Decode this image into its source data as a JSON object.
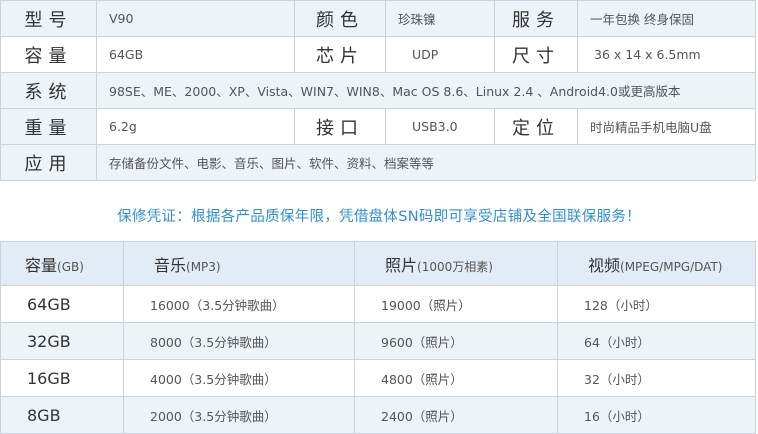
{
  "spec": {
    "model_label": "型号",
    "model_value": "V90",
    "color_label": "颜色",
    "color_value": "珍珠镍",
    "service_label": "服务",
    "service_value": "一年包换 终身保固",
    "capacity_label": "容量",
    "capacity_value": "64GB",
    "chip_label": "芯片",
    "chip_value": "UDP",
    "size_label": "尺寸",
    "size_value": "36 x 14 x 6.5mm",
    "system_label": "系统",
    "system_value": "98SE、ME、2000、XP、Vista、WIN7、WIN8、Mac OS 8.6、Linux 2.4 、Android4.0或更高版本",
    "weight_label": "重量",
    "weight_value": "6.2g",
    "interface_label": "接口",
    "interface_value": "USB3.0",
    "position_label": "定位",
    "position_value": "时尚精品手机电脑U盘",
    "usage_label": "应用",
    "usage_value": "存储备份文件、电影、音乐、图片、软件、资料、档案等等"
  },
  "notice": "保修凭证：根据各产品质保年限，凭借盘体SN码即可享受店铺及全国联保服务！",
  "capacity_table": {
    "headers": [
      {
        "main": "容量",
        "unit": "(GB)"
      },
      {
        "main": "音乐",
        "unit": "(MP3)"
      },
      {
        "main": "照片",
        "unit": "(1000万相素)"
      },
      {
        "main": "视频",
        "unit": "(MPEG/MPG/DAT)"
      }
    ],
    "rows": [
      {
        "capacity": "64GB",
        "music": "16000（3.5分钟歌曲）",
        "photo": "19000（照片）",
        "video": "128（小时）"
      },
      {
        "capacity": "32GB",
        "music": "8000（3.5分钟歌曲）",
        "photo": "9600（照片）",
        "video": "64（小时）"
      },
      {
        "capacity": "16GB",
        "music": "4000（3.5分钟歌曲）",
        "photo": "4800（照片）",
        "video": "32（小时）"
      },
      {
        "capacity": "8GB",
        "music": "2000（3.5分钟歌曲）",
        "photo": "2400（照片）",
        "video": "16（小时）"
      }
    ]
  },
  "colors": {
    "accent": "#2e8fd0",
    "border": "#c9d3de",
    "row_shade": "#eef3f8",
    "header_bg": "#e1ecf6"
  }
}
